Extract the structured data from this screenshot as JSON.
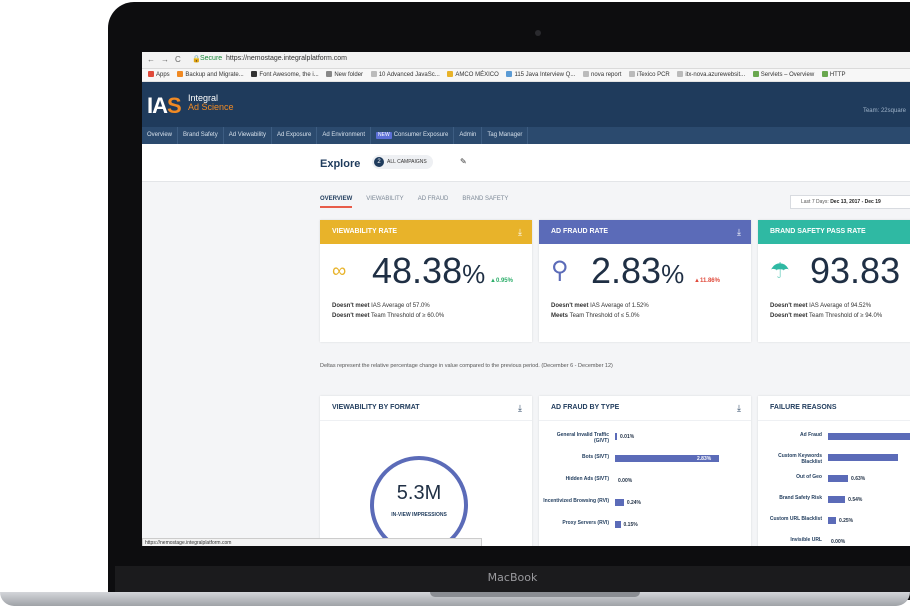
{
  "device": {
    "brand": "MacBook"
  },
  "browser": {
    "secure_label": "Secure",
    "url": "https://nemostage.integralplatform.com",
    "bookmarks": [
      "Apps",
      "Backup and Migrate...",
      "Font Awesome, the i...",
      "New folder",
      "10 Advanced JavaSc...",
      "AMCO MÉXICO",
      "115 Java Interview Q...",
      "nova report",
      "iTexico PCR",
      "itx-nova.azurewebsit...",
      "Servlets – Overview",
      "HTTP"
    ],
    "status_url": "https://nemostage.integralplatform.com"
  },
  "header": {
    "logo_mark": "IAS",
    "logo_line1": "Integral",
    "logo_line2": "Ad Science",
    "team_label": "Team: 22square"
  },
  "nav_tabs": [
    "Overview",
    "Brand Safety",
    "Ad Viewability",
    "Ad Exposure",
    "Ad Environment",
    "Consumer Exposure",
    "Admin",
    "Tag Manager"
  ],
  "new_badge": "NEW",
  "explore": {
    "title": "Explore",
    "campaign_count": "2",
    "campaign_label": "ALL CAMPAIGNS"
  },
  "subtabs": [
    "OVERVIEW",
    "VIEWABILITY",
    "AD FRAUD",
    "BRAND SAFETY"
  ],
  "date_range": {
    "label": "Last 7 Days:",
    "value": "Dec 13, 2017 - Dec 19"
  },
  "kpi_cards": [
    {
      "title": "VIEWABILITY RATE",
      "color": "#e8b32a",
      "icon": "binoculars-icon",
      "icon_glyph": "∞",
      "value": "48.38",
      "unit": "%",
      "delta": "▲0.95%",
      "delta_color": "#2eae6b",
      "line1_bold": "Doesn't meet",
      "line1_rest": " IAS Average of 57.0%",
      "line2_bold": "Doesn't meet",
      "line2_rest": " Team Threshold of ≥ 60.0%"
    },
    {
      "title": "AD FRAUD RATE",
      "color": "#5b6bb8",
      "icon": "magnifier-icon",
      "icon_glyph": "⚲",
      "value": "2.83",
      "unit": "%",
      "delta": "▲11.86%",
      "delta_color": "#e04b3c",
      "line1_bold": "Doesn't meet",
      "line1_rest": " IAS Average of 1.52%",
      "line2_bold": "Meets",
      "line2_rest": " Team Threshold of ≤ 5.0%"
    },
    {
      "title": "BRAND SAFETY PASS RATE",
      "color": "#2fb9a3",
      "icon": "umbrella-icon",
      "icon_glyph": "☂",
      "value": "93.83",
      "unit": "",
      "delta": "",
      "delta_color": "#2eae6b",
      "line1_bold": "Doesn't meet",
      "line1_rest": " IAS Average of 94.52%",
      "line2_bold": "Doesn't meet",
      "line2_rest": " Team Threshold of ≥ 94.0%"
    }
  ],
  "deltas_note": "Deltas represent the relative percentage change in value compared to the previous period. (December 6 - December 12)",
  "viewability_by_format": {
    "title": "VIEWABILITY BY FORMAT",
    "value": "5.3M",
    "label": "IN-VIEW IMPRESSIONS"
  },
  "ad_fraud_by_type": {
    "title": "AD FRAUD BY TYPE",
    "rows": [
      {
        "label": "General Invalid Traffic (GIVT)",
        "value": 0.01,
        "text": "0.01%"
      },
      {
        "label": "Bots (SIVT)",
        "value": 2.83,
        "text": "2.83%"
      },
      {
        "label": "Hidden Ads (SIVT)",
        "value": 0.0,
        "text": "0.00%"
      },
      {
        "label": "Incentivized Browsing (RVI)",
        "value": 0.24,
        "text": "0.24%"
      },
      {
        "label": "Proxy Servers (RVI)",
        "value": 0.15,
        "text": "0.15%"
      }
    ]
  },
  "failure_reasons": {
    "title": "FAILURE REASONS",
    "rows": [
      {
        "label": "Ad Fraud",
        "value": 2.83,
        "text": ""
      },
      {
        "label": "Custom Keywords Blacklist",
        "value": 2.2,
        "text": ""
      },
      {
        "label": "Out of Geo",
        "value": 0.63,
        "text": "0.63%"
      },
      {
        "label": "Brand Safety Risk",
        "value": 0.54,
        "text": "0.54%"
      },
      {
        "label": "Custom URL Blacklist",
        "value": 0.25,
        "text": "0.25%"
      },
      {
        "label": "Invisible URL",
        "value": 0.0,
        "text": "0.00%"
      }
    ]
  }
}
